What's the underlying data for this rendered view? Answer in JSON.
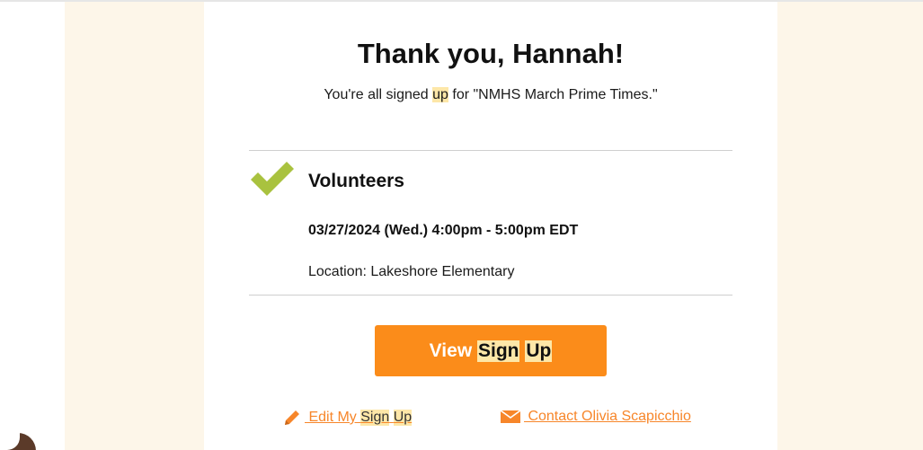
{
  "header": {
    "title": "Thank you, Hannah!",
    "subtitle_before": "You're all signed ",
    "subtitle_highlight": "up",
    "subtitle_after": " for \"NMHS March Prime Times.\""
  },
  "slot": {
    "title": "Volunteers",
    "datetime": "03/27/2024 (Wed.) 4:00pm - 5:00pm EDT",
    "location": "Location: Lakeshore Elementary"
  },
  "actions": {
    "view_prefix": "View ",
    "view_highlight_1": "Sign",
    "view_space": " ",
    "view_highlight_2": "Up",
    "edit_prefix": " Edit My ",
    "edit_highlight_1": "Sign",
    "edit_space": " ",
    "edit_highlight_2": "Up",
    "contact_label": " Contact Olivia Scapicchio"
  },
  "icons": {
    "check": "checkmark-icon",
    "edit": "pencil-icon",
    "contact": "envelope-icon"
  },
  "colors": {
    "accent": "#fb8c1a",
    "check": "#a9c23f",
    "link": "#f7862a",
    "highlight": "#fde7a8",
    "band": "#fdf6e9"
  }
}
